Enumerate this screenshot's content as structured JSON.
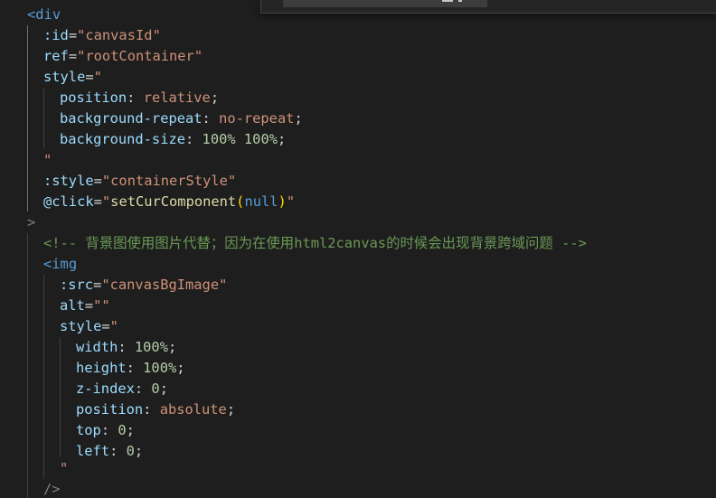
{
  "editor": {
    "find_widget": {
      "search_value": "",
      "icons": [
        "match-case-icon",
        "regex-icon"
      ]
    },
    "top_partial": "<",
    "lines": {
      "l1": {
        "open": "<",
        "tag": "div"
      },
      "l2": {
        "attr": ":id",
        "eq": "=",
        "value": "\"canvasId\""
      },
      "l3": {
        "attr": "ref",
        "eq": "=",
        "value": "\"rootContainer\""
      },
      "l4": {
        "attr": "style",
        "eq": "=",
        "value": "\""
      },
      "l5": {
        "prop": "position",
        "colon": ": ",
        "value": "relative",
        "semi": ";"
      },
      "l6": {
        "prop": "background-repeat",
        "colon": ": ",
        "value": "no-repeat",
        "semi": ";"
      },
      "l7": {
        "prop": "background-size",
        "colon": ": ",
        "value1": "100%",
        "space": " ",
        "value2": "100%",
        "semi": ";"
      },
      "l8": {
        "quote": "\""
      },
      "l9": {
        "attr": ":style",
        "eq": "=",
        "value": "\"containerStyle\""
      },
      "l10": {
        "attr": "@click",
        "eq": "=",
        "q1": "\"",
        "fn": "setCurComponent",
        "po": "(",
        "arg": "null",
        "pc": ")",
        "q2": "\""
      },
      "l11": {
        "close": ">"
      },
      "l12": {
        "comment": "<!-- 背景图使用图片代替；因为在使用html2canvas的时候会出现背景跨域问题 -->"
      },
      "l13": {
        "open": "<",
        "tag": "img"
      },
      "l14": {
        "attr": ":src",
        "eq": "=",
        "value": "\"canvasBgImage\""
      },
      "l15": {
        "attr": "alt",
        "eq": "=",
        "value": "\"\""
      },
      "l16": {
        "attr": "style",
        "eq": "=",
        "value": "\""
      },
      "l17": {
        "prop": "width",
        "colon": ": ",
        "value": "100%",
        "semi": ";"
      },
      "l18": {
        "prop": "height",
        "colon": ": ",
        "value": "100%",
        "semi": ";"
      },
      "l19": {
        "prop": "z-index",
        "colon": ": ",
        "value": "0",
        "semi": ";"
      },
      "l20": {
        "prop": "position",
        "colon": ": ",
        "value": "absolute",
        "semi": ";"
      },
      "l21": {
        "prop": "top",
        "colon": ": ",
        "value": "0",
        "semi": ";"
      },
      "l22": {
        "prop": "left",
        "colon": ": ",
        "value": "0",
        "semi": ";"
      },
      "l23": {
        "quote": "\""
      },
      "l24": {
        "close": "/>"
      }
    }
  }
}
